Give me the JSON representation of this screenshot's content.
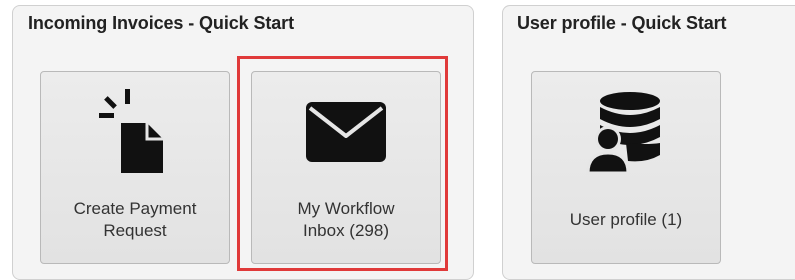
{
  "panels": [
    {
      "title": "Incoming Invoices - Quick Start",
      "tiles": [
        {
          "label_line1": "Create Payment",
          "label_line2": "Request",
          "icon": "new-document-icon"
        },
        {
          "label_line1": "My Workflow",
          "label_line2": "Inbox (298)",
          "icon": "envelope-icon"
        }
      ]
    },
    {
      "title": "User profile - Quick Start",
      "tiles": [
        {
          "label_line1": "User profile (1)",
          "label_line2": "",
          "icon": "user-database-icon"
        }
      ]
    }
  ],
  "highlight_color": "#e03a3a"
}
